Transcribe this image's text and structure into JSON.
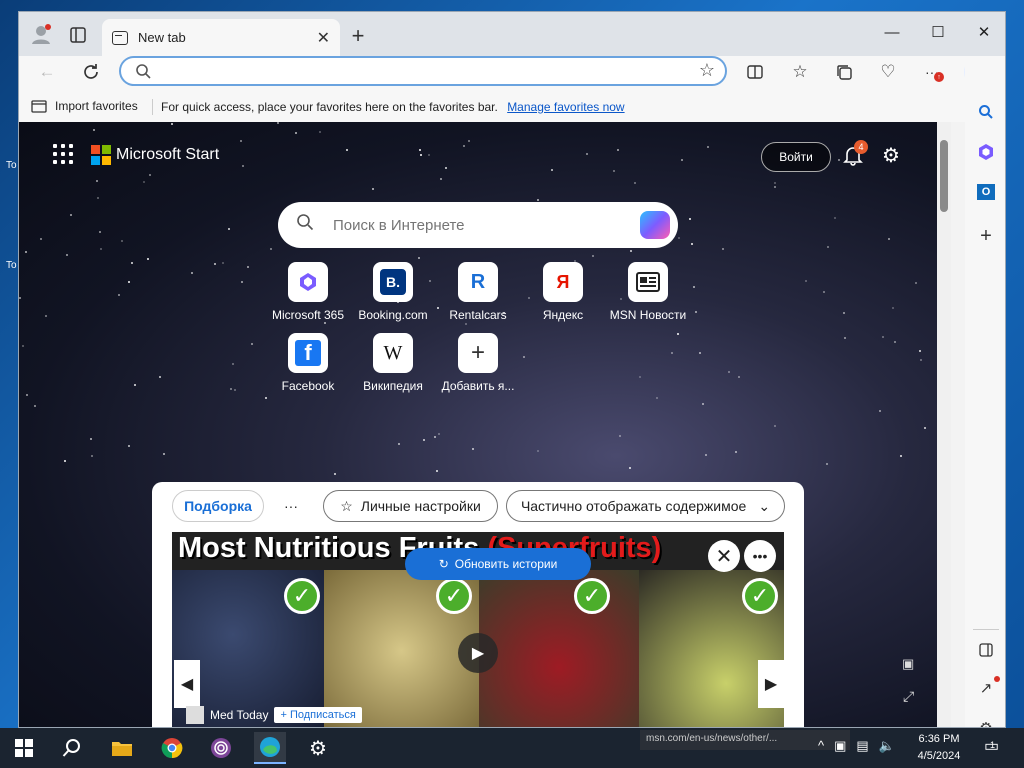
{
  "desktop": {
    "icon_labels": [
      "To",
      "To"
    ]
  },
  "tab": {
    "title": "New tab"
  },
  "address": {
    "placeholder": ""
  },
  "favorites": {
    "import_label": "Import favorites",
    "message": "For quick access, place your favorites here on the favorites bar.",
    "manage_link": "Manage favorites now"
  },
  "header": {
    "brand": "Microsoft Start",
    "signin": "Войти",
    "notification_count": "4"
  },
  "search": {
    "placeholder": "Поиск в Интернете"
  },
  "quick_links": [
    {
      "label": "Microsoft 365",
      "icon": "microsoft365-icon"
    },
    {
      "label": "Booking.com",
      "icon": "booking-icon"
    },
    {
      "label": "Rentalcars",
      "icon": "rentalcars-icon"
    },
    {
      "label": "Яндекс",
      "icon": "yandex-icon"
    },
    {
      "label": "MSN Новости",
      "icon": "msn-news-icon"
    },
    {
      "label": "Facebook",
      "icon": "facebook-icon"
    },
    {
      "label": "Википедия",
      "icon": "wikipedia-icon"
    },
    {
      "label": "Добавить я...",
      "icon": "plus-icon"
    }
  ],
  "feed": {
    "tab_selected": "Подборка",
    "more": "···",
    "personalize": "Личные настройки",
    "content_mode": "Частично отображать содержимое",
    "refresh": "Обновить истории",
    "headline_white": "Most Nutritious Fruits ",
    "headline_red": "(Superfruits)",
    "source": "Med Today",
    "follow": "+ Подписаться"
  },
  "taskbar": {
    "status_url": "msn.com/en-us/news/other/...",
    "time": "6:36 PM",
    "date": "4/5/2024",
    "notif_count": "1"
  },
  "colors": {
    "accent": "#1a6fd6",
    "bing_blue": "#1b6fd8",
    "badge": "#e65c2e"
  }
}
